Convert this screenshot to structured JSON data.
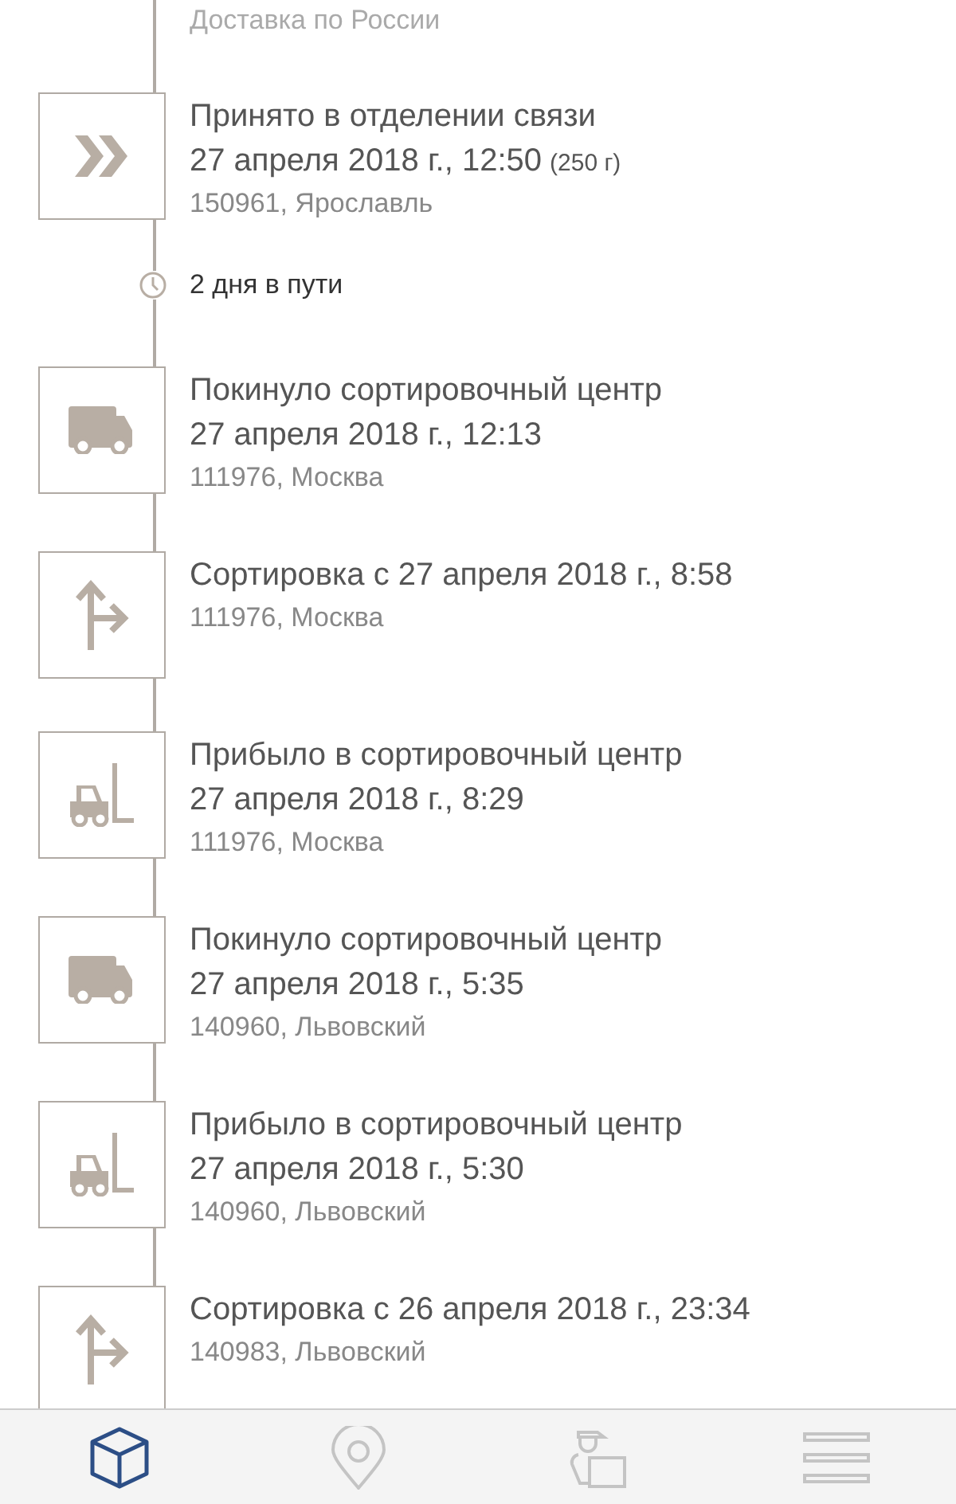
{
  "header": {
    "subtitle": "Доставка по России"
  },
  "events": [
    {
      "kind": "accepted",
      "title": "Принято в отделении связи",
      "date": "27 апреля 2018 г., 12:50",
      "weight": "(250 г)",
      "place": "150961, Ярославль"
    },
    {
      "kind": "transit",
      "title": "2 дня в пути"
    },
    {
      "kind": "truck",
      "title": "Покинуло сортировочный центр",
      "date": "27 апреля 2018 г., 12:13",
      "place": "111976, Москва"
    },
    {
      "kind": "sorting",
      "title": "Сортировка с 27 апреля 2018 г., 8:58",
      "place": "111976, Москва"
    },
    {
      "kind": "forklift",
      "title": "Прибыло в сортировочный центр",
      "date": "27 апреля 2018 г., 8:29",
      "place": "111976, Москва"
    },
    {
      "kind": "truck",
      "title": "Покинуло сортировочный центр",
      "date": "27 апреля 2018 г., 5:35",
      "place": "140960, Львовский"
    },
    {
      "kind": "forklift",
      "title": "Прибыло в сортировочный центр",
      "date": "27 апреля 2018 г., 5:30",
      "place": "140960, Львовский"
    },
    {
      "kind": "sorting",
      "title": "Сортировка с 26 апреля 2018 г., 23:34",
      "place": "140983, Львовский"
    }
  ],
  "tab_bar": [
    {
      "kind": "parcels",
      "selected": true
    },
    {
      "kind": "map",
      "selected": false
    },
    {
      "kind": "courier",
      "selected": false
    },
    {
      "kind": "menu",
      "selected": false
    }
  ]
}
